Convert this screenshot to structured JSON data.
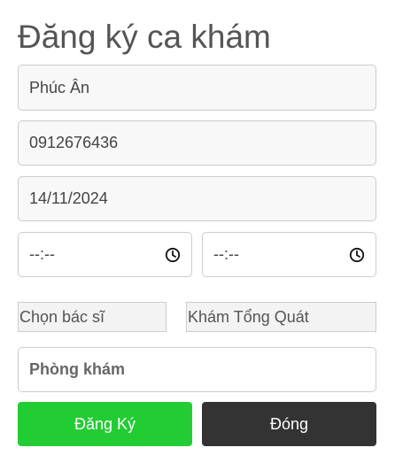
{
  "form": {
    "title": "Đăng ký ca khám",
    "patient_name": "Phúc Ân",
    "phone": "0912676436",
    "date": "14/11/2024",
    "start_time": "--:--",
    "end_time": "--:--",
    "doctor_select": "Chọn bác sĩ",
    "exam_type_select": "Khám Tổng Quát",
    "clinic_placeholder": "Phòng khám",
    "submit_label": "Đăng Ký",
    "close_label": "Đóng"
  },
  "icons": {
    "time_icon": "clock-icon"
  },
  "colors": {
    "submit_button": "#22cc33",
    "close_button": "#333333",
    "title": "#555555"
  }
}
